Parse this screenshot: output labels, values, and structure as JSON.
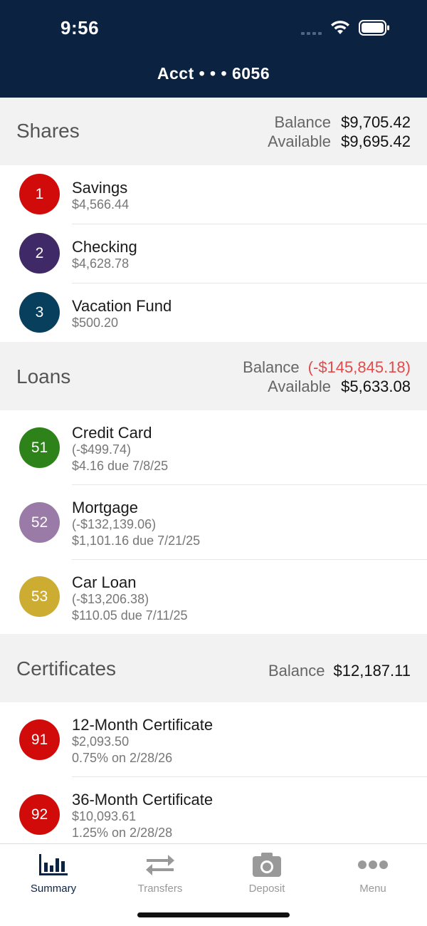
{
  "status": {
    "time": "9:56"
  },
  "header": {
    "title": "Acct • • • 6056"
  },
  "shares": {
    "title": "Shares",
    "balance_label": "Balance",
    "balance": "$9,705.42",
    "available_label": "Available",
    "available": "$9,695.42",
    "items": [
      {
        "num": "1",
        "name": "Savings",
        "amount": "$4,566.44",
        "color": "#d10a0a"
      },
      {
        "num": "2",
        "name": "Checking",
        "amount": "$4,628.78",
        "color": "#3f2a67"
      },
      {
        "num": "3",
        "name": "Vacation Fund",
        "amount": "$500.20",
        "color": "#083f5c"
      }
    ]
  },
  "loans": {
    "title": "Loans",
    "balance_label": "Balance",
    "balance": "(-$145,845.18)",
    "available_label": "Available",
    "available": "$5,633.08",
    "items": [
      {
        "num": "51",
        "name": "Credit Card",
        "amount": "(-$499.74)",
        "due": "$4.16 due 7/8/25",
        "color": "#2d8319"
      },
      {
        "num": "52",
        "name": "Mortgage",
        "amount": "(-$132,139.06)",
        "due": "$1,101.16 due 7/21/25",
        "color": "#9a7aa6"
      },
      {
        "num": "53",
        "name": "Car Loan",
        "amount": "(-$13,206.38)",
        "due": "$110.05 due 7/11/25",
        "color": "#ccad32"
      }
    ]
  },
  "certificates": {
    "title": "Certificates",
    "balance_label": "Balance",
    "balance": "$12,187.11",
    "items": [
      {
        "num": "91",
        "name": "12-Month Certificate",
        "amount": "$2,093.50",
        "rate": "0.75% on 2/28/26",
        "color": "#d10a0a"
      },
      {
        "num": "92",
        "name": "36-Month Certificate",
        "amount": "$10,093.61",
        "rate": "1.25% on 2/28/28",
        "color": "#d10a0a"
      }
    ]
  },
  "tabs": [
    {
      "label": "Summary",
      "icon": "bar-chart-icon",
      "active": true
    },
    {
      "label": "Transfers",
      "icon": "transfer-arrows-icon",
      "active": false
    },
    {
      "label": "Deposit",
      "icon": "camera-icon",
      "active": false
    },
    {
      "label": "Menu",
      "icon": "more-dots-icon",
      "active": false
    }
  ]
}
